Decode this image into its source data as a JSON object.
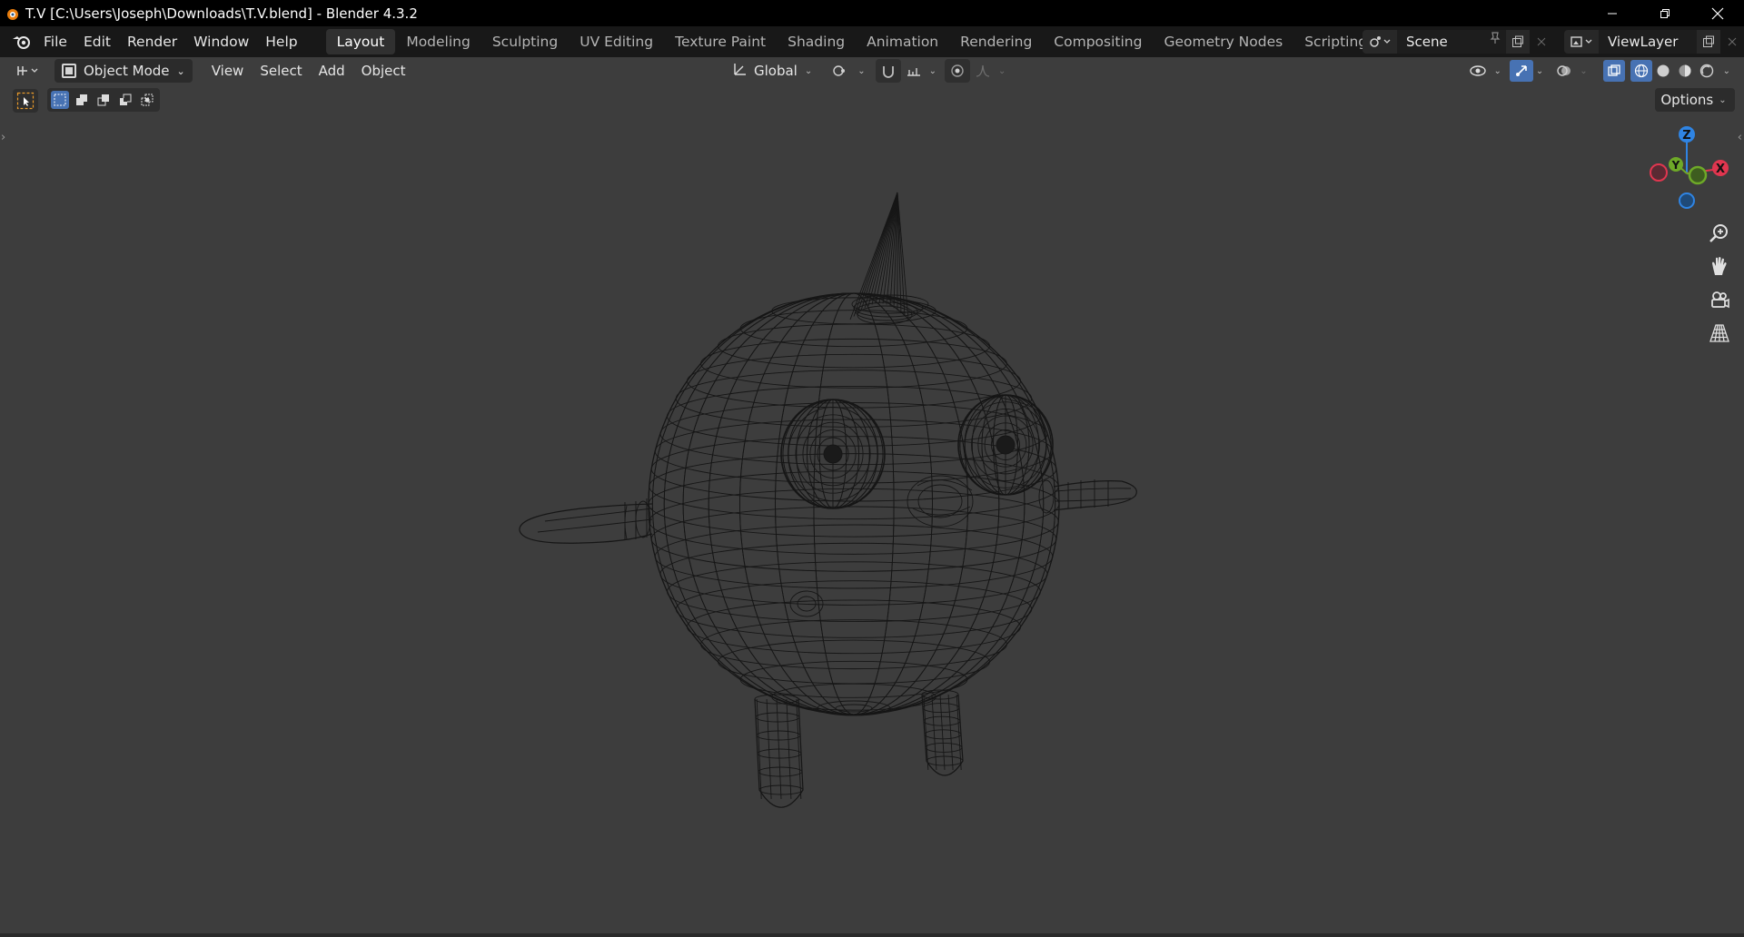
{
  "window": {
    "title": "T.V [C:\\Users\\Joseph\\Downloads\\T.V.blend] - Blender 4.3.2"
  },
  "menu": {
    "items": [
      "File",
      "Edit",
      "Render",
      "Window",
      "Help"
    ]
  },
  "workspaces": {
    "tabs": [
      "Layout",
      "Modeling",
      "Sculpting",
      "UV Editing",
      "Texture Paint",
      "Shading",
      "Animation",
      "Rendering",
      "Compositing",
      "Geometry Nodes",
      "Scripting"
    ],
    "active": "Layout",
    "add_label": "+"
  },
  "scene": {
    "name": "Scene"
  },
  "view_layer": {
    "name": "ViewLayer"
  },
  "viewport_header": {
    "mode": "Object Mode",
    "menus": [
      "View",
      "Select",
      "Add",
      "Object"
    ],
    "orientation": "Global"
  },
  "tool_header": {
    "options_label": "Options"
  },
  "gizmo": {
    "z_label": "Z",
    "y_label": "Y",
    "x_label": "X",
    "colors": {
      "x": "#e0364f",
      "y": "#6ea928",
      "z": "#2f84e3"
    }
  },
  "viewport": {
    "shading": "wireframe",
    "background": "#3d3d3d"
  },
  "icons": [
    "blender-icon",
    "minimize-icon",
    "restore-icon",
    "close-icon",
    "editor-type-icon",
    "object-mode-icon",
    "transform-orientation-icon",
    "pivot-icon",
    "snap-icon",
    "proportional-editing-icon",
    "visibility-icon",
    "gizmo-icon",
    "overlay-icon",
    "xray-icon",
    "wireframe-shading-icon",
    "solid-shading-icon",
    "material-shading-icon",
    "rendered-shading-icon",
    "zoom-icon",
    "pan-hand-icon",
    "camera-view-icon",
    "perspective-grid-icon"
  ]
}
